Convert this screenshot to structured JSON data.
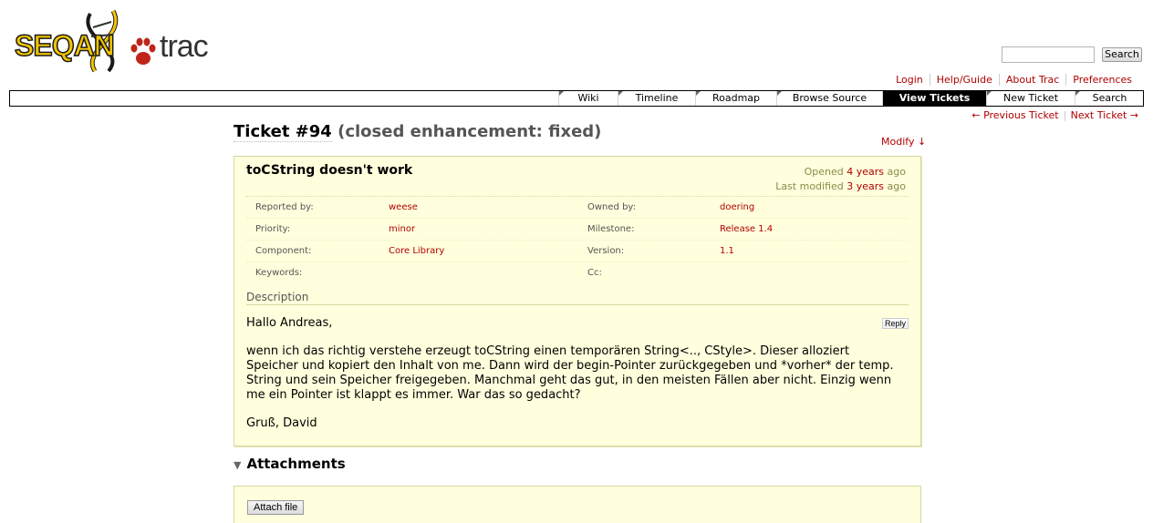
{
  "logo": {
    "project": "SEQAN",
    "product": "trac"
  },
  "search": {
    "button_label": "Search",
    "value": ""
  },
  "metanav": [
    "Login",
    "Help/Guide",
    "About Trac",
    "Preferences"
  ],
  "mainnav": [
    {
      "label": "Wiki",
      "active": false
    },
    {
      "label": "Timeline",
      "active": false
    },
    {
      "label": "Roadmap",
      "active": false
    },
    {
      "label": "Browse Source",
      "active": false
    },
    {
      "label": "View Tickets",
      "active": true
    },
    {
      "label": "New Ticket",
      "active": false
    },
    {
      "label": "Search",
      "active": false
    }
  ],
  "ctxnav": {
    "prev": "← Previous Ticket",
    "next": "Next Ticket →"
  },
  "ticket": {
    "id": "Ticket #94",
    "status": "(closed enhancement: fixed)",
    "modify": "Modify ↓",
    "summary": "toCString doesn't work",
    "opened_prefix": "Opened",
    "opened_link": "4 years",
    "opened_suffix": "ago",
    "modified_prefix": "Last modified",
    "modified_link": "3 years",
    "modified_suffix": "ago",
    "props": {
      "reported_by_label": "Reported by:",
      "reported_by": "weese",
      "owned_by_label": "Owned by:",
      "owned_by": "doering",
      "priority_label": "Priority:",
      "priority": "minor",
      "milestone_label": "Milestone:",
      "milestone": "Release 1.4",
      "component_label": "Component:",
      "component": "Core Library",
      "version_label": "Version:",
      "version": "1.1",
      "keywords_label": "Keywords:",
      "keywords": "",
      "cc_label": "Cc:",
      "cc": ""
    },
    "description_label": "Description",
    "reply": "Reply",
    "description": {
      "p1": "Hallo Andreas,",
      "p2": "wenn ich das richtig verstehe erzeugt toCString einen temporären String<.., CStyle>. Dieser alloziert Speicher und kopiert den Inhalt von me. Dann wird der begin-Pointer zurückgegeben und *vorher* der temp. String und sein Speicher freigegeben. Manchmal geht das gut, in den meisten Fällen aber nicht. Einzig wenn me ein Pointer ist klappt es immer. War das so gedacht?",
      "p3": "Gruß, David"
    }
  },
  "attachments": {
    "title": "Attachments",
    "attach_button": "Attach file"
  }
}
